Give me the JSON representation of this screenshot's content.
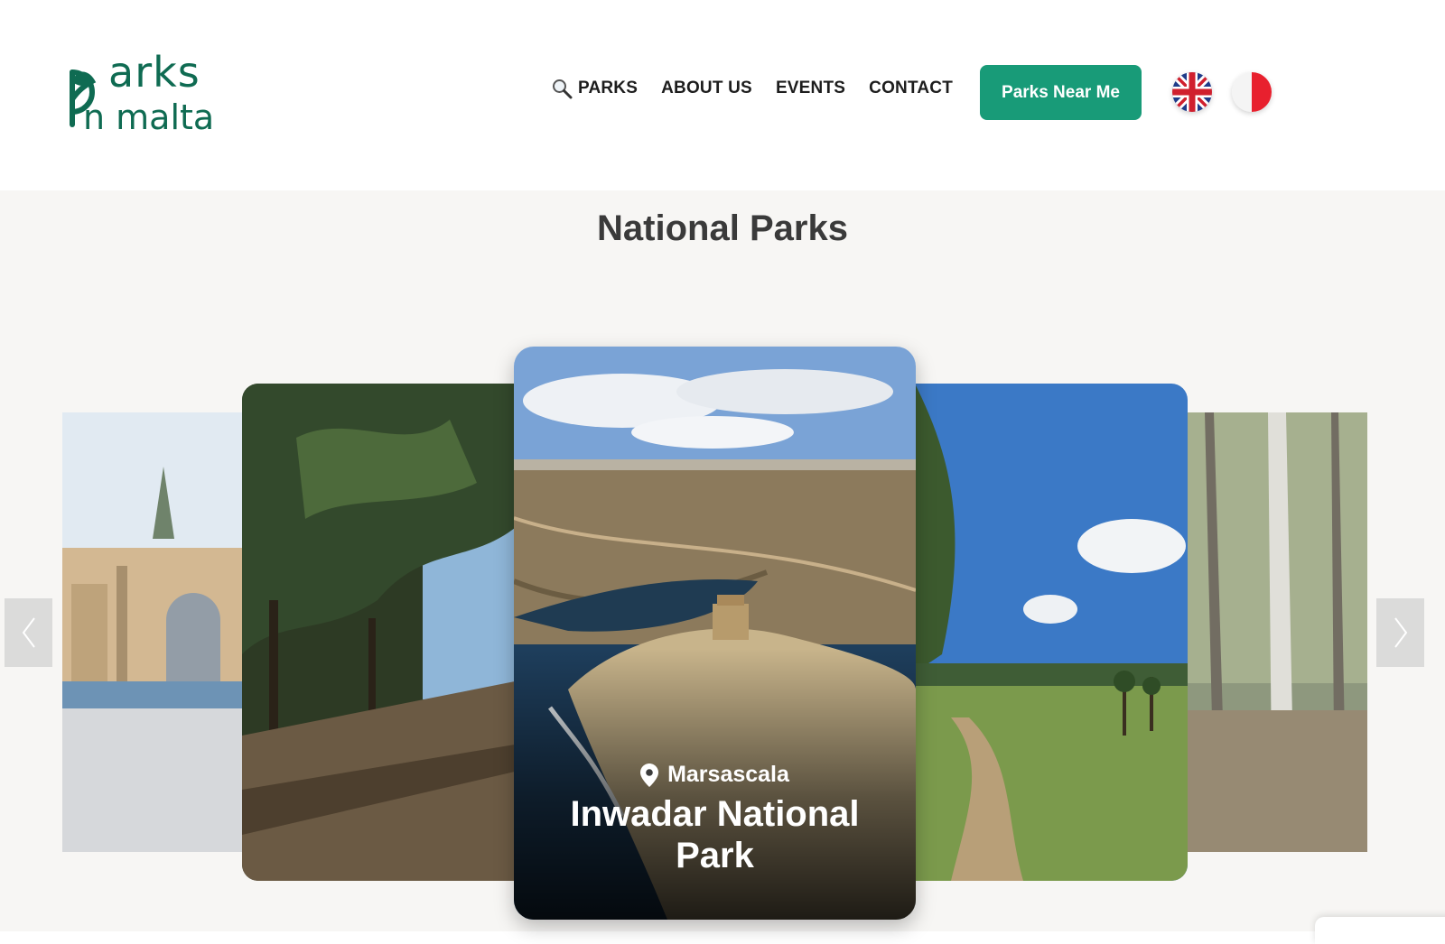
{
  "brand": {
    "logo_line1": "Parks",
    "logo_line2": "In Malta",
    "logo_color": "#0f6b52"
  },
  "nav": {
    "items": [
      {
        "label": "PARKS",
        "icon": "search-icon"
      },
      {
        "label": "ABOUT US"
      },
      {
        "label": "EVENTS"
      },
      {
        "label": "CONTACT"
      }
    ],
    "cta_label": "Parks Near Me",
    "cta_color": "#189b78",
    "languages": [
      {
        "icon": "uk-flag-icon"
      },
      {
        "icon": "malta-flag-icon"
      }
    ]
  },
  "section": {
    "title": "National Parks",
    "featured": {
      "location": "Marsascala",
      "name": "Inwadar National Park",
      "location_icon": "map-pin-icon"
    },
    "carousel_controls": {
      "prev_icon": "chevron-left-icon",
      "next_icon": "chevron-right-icon"
    }
  }
}
